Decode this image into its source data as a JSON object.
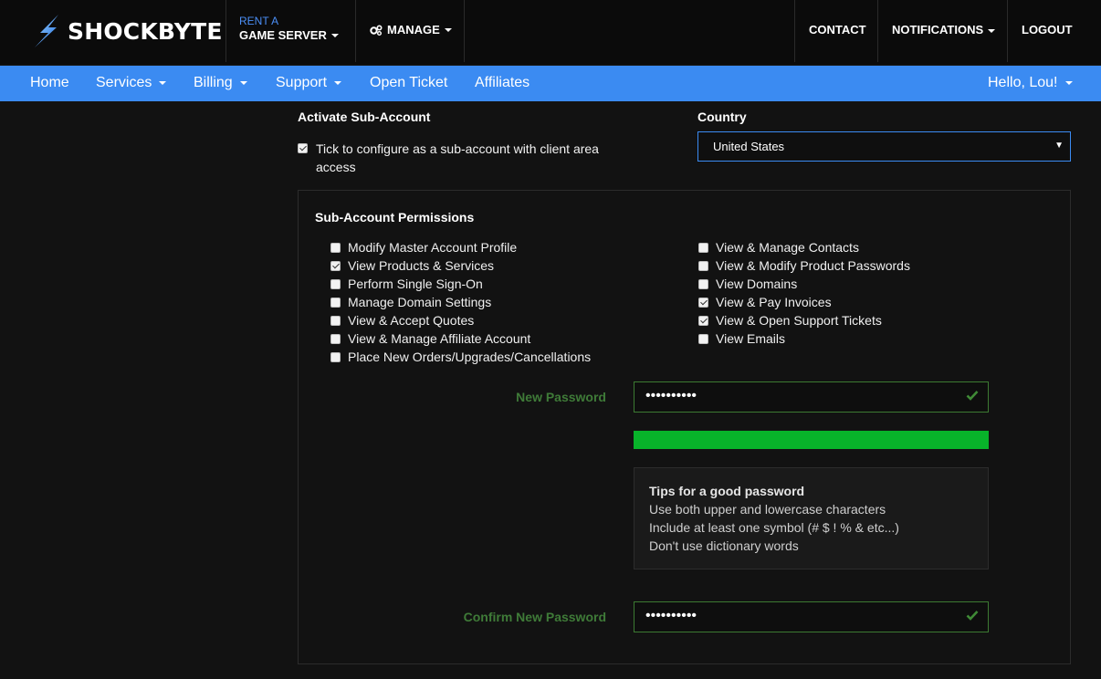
{
  "header": {
    "logo_text": "SHOCKBYTE",
    "rent_small": "RENT A",
    "rent_big": "GAME SERVER",
    "manage": "MANAGE",
    "contact": "CONTACT",
    "notifications": "NOTIFICATIONS",
    "logout": "LOGOUT"
  },
  "nav": {
    "home": "Home",
    "services": "Services",
    "billing": "Billing",
    "support": "Support",
    "open_ticket": "Open Ticket",
    "affiliates": "Affiliates",
    "user": "Hello, Lou!"
  },
  "form": {
    "activate_label": "Activate Sub-Account",
    "activate_text_1": "Tick to configure as a sub-account with client area",
    "activate_text_2": "access",
    "activate_checked": true,
    "country_label": "Country",
    "country_value": "United States",
    "permissions_title": "Sub-Account Permissions",
    "permissions_left": [
      {
        "label": "Modify Master Account Profile",
        "checked": false
      },
      {
        "label": "View Products & Services",
        "checked": true
      },
      {
        "label": "Perform Single Sign-On",
        "checked": false
      },
      {
        "label": "Manage Domain Settings",
        "checked": false
      },
      {
        "label": "View & Accept Quotes",
        "checked": false
      },
      {
        "label": "View & Manage Affiliate Account",
        "checked": false
      },
      {
        "label": "Place New Orders/Upgrades/Cancellations",
        "checked": false
      }
    ],
    "permissions_right": [
      {
        "label": "View & Manage Contacts",
        "checked": false
      },
      {
        "label": "View & Modify Product Passwords",
        "checked": false
      },
      {
        "label": "View Domains",
        "checked": false
      },
      {
        "label": "View & Pay Invoices",
        "checked": true
      },
      {
        "label": "View & Open Support Tickets",
        "checked": true
      },
      {
        "label": "View Emails",
        "checked": false
      }
    ],
    "new_password_label": "New Password",
    "new_password_value": "••••••••••",
    "password_strength": 1.0,
    "tips_title": "Tips for a good password",
    "tips": [
      "Use both upper and lowercase characters",
      "Include at least one symbol (# $ ! % & etc...)",
      "Don't use dictionary words"
    ],
    "confirm_password_label": "Confirm New Password",
    "confirm_password_value": "••••••••••"
  },
  "colors": {
    "nav_blue": "#3b8bf2",
    "valid_green": "#3f7b38",
    "strength_green": "#08b32a"
  }
}
